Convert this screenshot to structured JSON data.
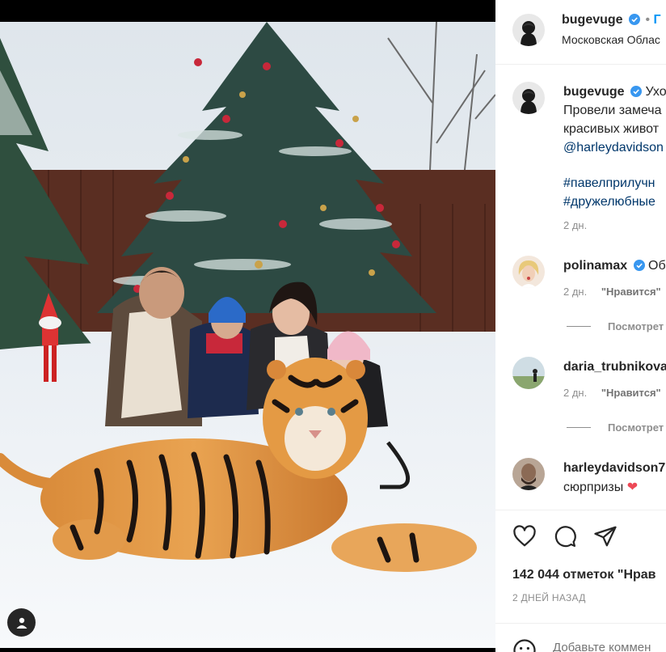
{
  "post": {
    "author": "bugevuge",
    "follow_label": "Г",
    "location": "Московская Облас",
    "caption_lines": [
      "Ухо",
      "Провели замеча",
      "красивых живот",
      "@harleydavidson",
      "",
      "#павелприлучн",
      "#дружелюбные"
    ],
    "time": "2 дн.",
    "likes": "142 044 отметок \"Нрав",
    "date": "2 ДНЕЙ НАЗАД",
    "add_comment_placeholder": "Добавьте коммен"
  },
  "comments": [
    {
      "user": "polinamax",
      "verified": true,
      "text": "Об",
      "time": "2 дн.",
      "like_label": "\"Нравится\"",
      "view_replies": "Посмотрет"
    },
    {
      "user": "daria_trubnikova",
      "verified": false,
      "text": "",
      "time": "2 дн.",
      "like_label": "\"Нравится\"",
      "view_replies": "Посмотрет"
    },
    {
      "user": "harleydavidson7",
      "verified": false,
      "text": "сюрпризы",
      "emoji": "❤"
    }
  ],
  "colors": {
    "verified": "#3897f0",
    "link": "#00376b",
    "heart": "#ed4956"
  },
  "icons": {
    "heart": "heart-icon",
    "comment": "comment-icon",
    "share": "share-icon",
    "tag": "person-tag-icon",
    "emoji": "emoji-icon"
  }
}
